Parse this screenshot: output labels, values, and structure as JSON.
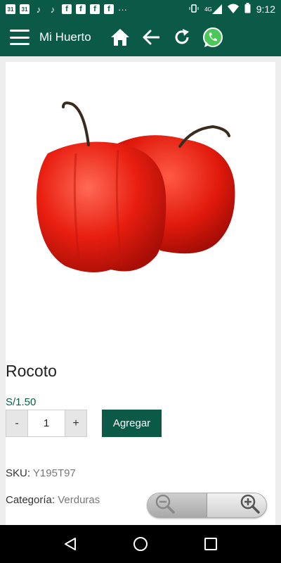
{
  "status_bar": {
    "time": "9:12",
    "left_icons": [
      "calendar-31-icon",
      "calendar-31-icon",
      "tiktok-icon",
      "tiktok-icon",
      "facebook-icon",
      "facebook-icon",
      "facebook-icon",
      "facebook-icon"
    ],
    "calendar_day": "31",
    "facebook_glyph": "f",
    "more": "···",
    "network": "4G"
  },
  "app_bar": {
    "title": "Mi Huerto",
    "icons": [
      "menu-icon",
      "home-icon",
      "back-arrow-icon",
      "refresh-icon",
      "whatsapp-icon"
    ],
    "color": "#0b5a48"
  },
  "product": {
    "name": "Rocoto",
    "price": "S/1.50",
    "quantity": "1",
    "decrement_label": "-",
    "increment_label": "+",
    "add_label": "Agregar",
    "sku_label": "SKU:",
    "sku_value": "Y195T97",
    "category_label": "Categoría:",
    "category_value": "Verduras"
  },
  "zoom_control": {
    "icons": [
      "zoom-out-icon",
      "zoom-in-icon"
    ]
  },
  "nav_bar": {
    "icons": [
      "back-triangle-icon",
      "home-circle-icon",
      "recents-square-icon"
    ]
  }
}
